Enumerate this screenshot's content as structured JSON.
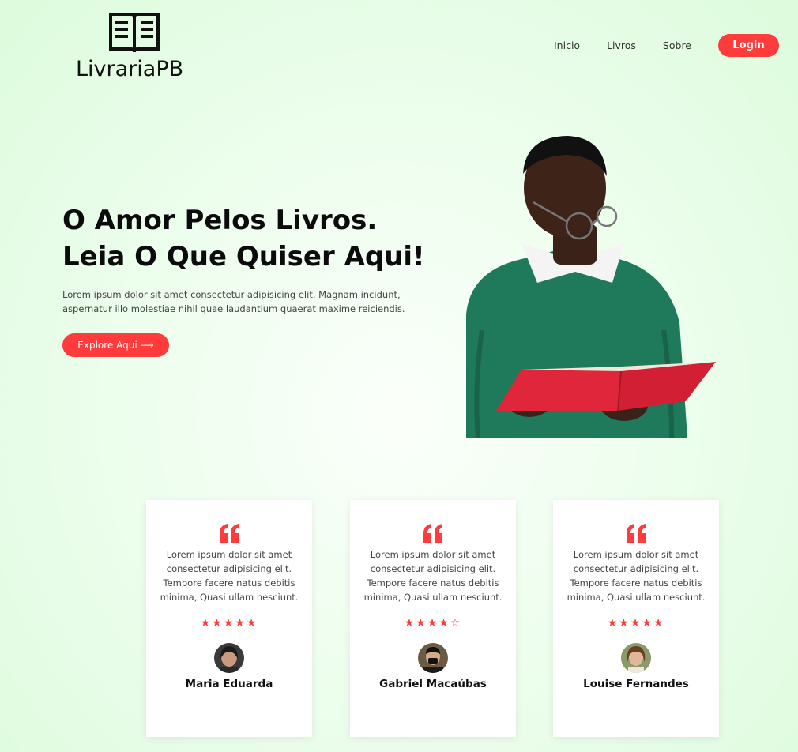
{
  "brand": {
    "name": "LivrariaPB",
    "logo_icon": "open-book-icon"
  },
  "nav": {
    "links": [
      "Inicio",
      "Livros",
      "Sobre"
    ],
    "login_label": "Login"
  },
  "hero": {
    "title_line1": "O Amor Pelos Livros.",
    "title_line2": "Leia O Que Quiser Aqui!",
    "description": "Lorem ipsum dolor sit amet consectetur adipisicing elit. Magnam incidunt, aspernatur illo molestiae nihil quae laudantium quaerat maxime reiciendis.",
    "cta_label": "Explore Aqui ⟶"
  },
  "testimonials": [
    {
      "text": "Lorem ipsum dolor sit amet consectetur adipisicing elit. Tempore facere natus debitis minima, Quasi ullam nesciunt.",
      "rating": 5,
      "stars": "★★★★★",
      "name": "Maria Eduarda"
    },
    {
      "text": "Lorem ipsum dolor sit amet consectetur adipisicing elit. Tempore facere natus debitis minima, Quasi ullam nesciunt.",
      "rating": 4,
      "stars": "★★★★☆",
      "name": "Gabriel Macaúbas"
    },
    {
      "text": "Lorem ipsum dolor sit amet consectetur adipisicing elit. Tempore facere natus debitis minima, Quasi ullam nesciunt.",
      "rating": 5,
      "stars": "★★★★★",
      "name": "Louise Fernandes"
    }
  ],
  "colors": {
    "accent": "#ff3b3b",
    "background": "#e8fde8",
    "sweater": "#1f7a5c",
    "book": "#e0263a"
  }
}
